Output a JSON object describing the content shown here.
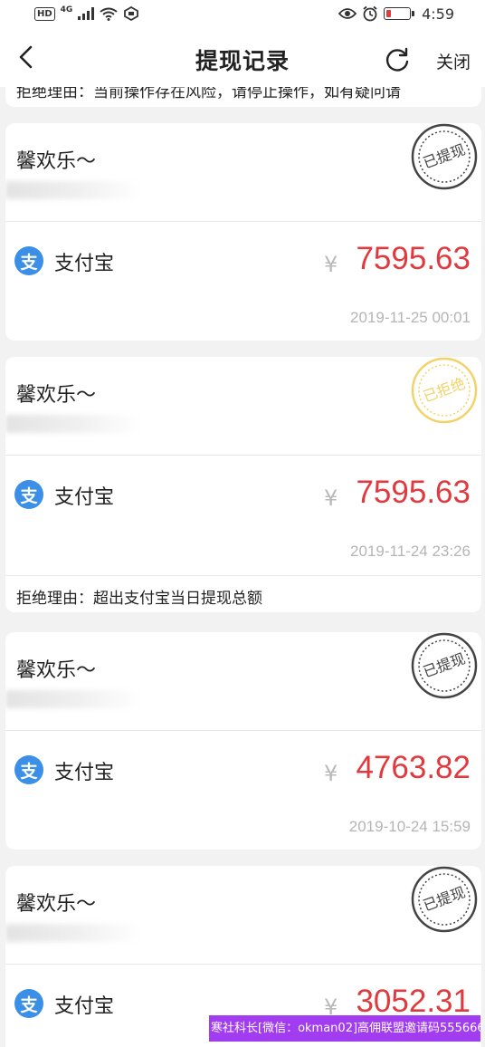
{
  "status_bar": {
    "network_hd": "HD",
    "network_gen": "4G",
    "time": "4:59"
  },
  "nav": {
    "title": "提现记录",
    "close_label": "关闭"
  },
  "partial_row_text": "拒绝理由：当前操作存在风险，请停止操作，如有疑问请",
  "records": [
    {
      "name": "馨欢乐～",
      "stamp": "已提现",
      "stamp_color": "#444444",
      "method": "支付宝",
      "method_icon": "支",
      "currency": "¥",
      "amount": "7595.63",
      "date": "2019-11-25 00:01",
      "reason": ""
    },
    {
      "name": "馨欢乐～",
      "stamp": "已拒绝",
      "stamp_color": "#f2d36a",
      "method": "支付宝",
      "method_icon": "支",
      "currency": "¥",
      "amount": "7595.63",
      "date": "2019-11-24 23:26",
      "reason": "拒绝理由：超出支付宝当日提现总额"
    },
    {
      "name": "馨欢乐～",
      "stamp": "已提现",
      "stamp_color": "#444444",
      "method": "支付宝",
      "method_icon": "支",
      "currency": "¥",
      "amount": "4763.82",
      "date": "2019-10-24 15:59",
      "reason": ""
    },
    {
      "name": "馨欢乐～",
      "stamp": "已提现",
      "stamp_color": "#444444",
      "method": "支付宝",
      "method_icon": "支",
      "currency": "¥",
      "amount": "3052.31",
      "date": "",
      "reason": ""
    }
  ],
  "watermark": {
    "line1": "寒社科长[微信：okman02]高佣联盟邀请码555666"
  },
  "colors": {
    "amount": "#e0393e",
    "alipay": "#3b8fe6",
    "watermark_bg": "#a23cf0"
  }
}
